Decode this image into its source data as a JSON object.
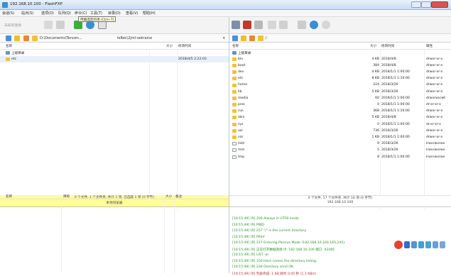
{
  "window": {
    "title": "192.168.10.100 - FlashFXP"
  },
  "menu": [
    "会话(S)",
    "站点(S)",
    "选项(O)",
    "队列(Q)",
    "命令(C)",
    "工具(T)",
    "目录(D)",
    "查看(V)",
    "帮助(H)"
  ],
  "local": {
    "toolbar": {
      "connect_label": "未知的连接"
    },
    "path": "D:\\Documents\\Tencen...",
    "path_tail": "leRec\\2jml-sekraine",
    "tooltip": "传输选定的项 (Ctrl+T)",
    "columns": {
      "name": "名称",
      "size": "大小",
      "modified": "修改时间"
    },
    "rows": [
      {
        "name": "上级目录",
        "size": "",
        "date": "",
        "icon": "up"
      },
      {
        "name": "etc",
        "size": "",
        "date": "2018/4/5 2:22:03",
        "icon": "folder"
      }
    ],
    "status": "0 个文件, 1 个文件夹, 共计 1 项, 已选取 1 项 (0 字节)",
    "status2": "本地浏览器"
  },
  "remote": {
    "path": "/",
    "columns": {
      "name": "名称",
      "size": "大小",
      "modified": "修改时间",
      "attr": "属性"
    },
    "rows": [
      {
        "name": "上级目录",
        "size": "",
        "date": "",
        "attr": "",
        "icon": "up"
      },
      {
        "name": "bin",
        "size": "4 KB",
        "date": "2018/4/8",
        "attr": "drwxr-xr-x",
        "icon": "folder"
      },
      {
        "name": "boot",
        "size": "384",
        "date": "2018/4/8",
        "attr": "drwxr-xr-x",
        "icon": "folder"
      },
      {
        "name": "dev",
        "size": "4 KB",
        "date": "2018/1/1 1:00:00",
        "attr": "drwxr-xr-x",
        "icon": "folder"
      },
      {
        "name": "etc",
        "size": "8 KB",
        "date": "2018/1/1 1:10:00",
        "attr": "drwxr-xr-x",
        "icon": "folder"
      },
      {
        "name": "home",
        "size": "224",
        "date": "2018/3/26",
        "attr": "drwxr-xr-x",
        "icon": "folder"
      },
      {
        "name": "lib",
        "size": "5 KB",
        "date": "2018/3/26",
        "attr": "drwxr-xr-x",
        "icon": "folder"
      },
      {
        "name": "media",
        "size": "60",
        "date": "2018/1/1 1:00:00",
        "attr": "drwxrwxrwt",
        "icon": "folder"
      },
      {
        "name": "proc",
        "size": "0",
        "date": "2018/1/1 1:00:00",
        "attr": "dr-xr-xr-x",
        "icon": "folder"
      },
      {
        "name": "run",
        "size": "368",
        "date": "2018/1/1 1:10:00",
        "attr": "drwxr-xr-x",
        "icon": "folder"
      },
      {
        "name": "sbin",
        "size": "5 KB",
        "date": "2018/4/8",
        "attr": "drwxr-xr-x",
        "icon": "folder"
      },
      {
        "name": "sys",
        "size": "0",
        "date": "2018/1/1 1:00:00",
        "attr": "dr-xr-xr-x",
        "icon": "folder"
      },
      {
        "name": "usr",
        "size": "736",
        "date": "2018/3/26",
        "attr": "drwxr-xr-x",
        "icon": "folder"
      },
      {
        "name": "var",
        "size": "1 KB",
        "date": "2018/1/1 1:00:00",
        "attr": "drwxr-xr-x",
        "icon": "folder"
      },
      {
        "name": "hdd",
        "size": "9",
        "date": "2018/3/26",
        "attr": "lrwxrwxrwx",
        "icon": "link"
      },
      {
        "name": "mnt",
        "size": "5",
        "date": "2018/3/26",
        "attr": "lrwxrwxrwx",
        "icon": "link"
      },
      {
        "name": "tmp",
        "size": "8",
        "date": "2018/1/1 1:00:00",
        "attr": "lrwxrwxrwx",
        "icon": "link"
      }
    ],
    "status": "0 个文件, 17 个文件夹, 共计 16 项 (0 字节)",
    "status2": "192.168.10.100"
  },
  "queue": {
    "columns": {
      "name": "名称",
      "target": "目标",
      "size": "大小",
      "note": "备注"
    }
  },
  "log": {
    "lines": [
      "[10:15:49] [R] 200 Always in UTF8 mode.",
      "[10:15:49] [R] PWD",
      "[10:15:49] [R] 257 \"/\" is the current directory",
      "[10:15:49] [R] PASV",
      "[10:15:49] [R] 227 Entering Passive Mode (192,168,10,100,165,245).",
      "[10:15:49] [R] 正在打开数据连接 IP: 192.168.10.100 端口: 42485",
      "[10:15:49] [R] LIST -al",
      "[10:15:49] [R] 150 Here comes the directory listing.",
      "[10:15:49] [R] 226 Directory send OK.",
      "[10:15:49] [R] 列表完成: 1 KB 耗时 0.05 秒 (1.1 KB/s)"
    ]
  }
}
